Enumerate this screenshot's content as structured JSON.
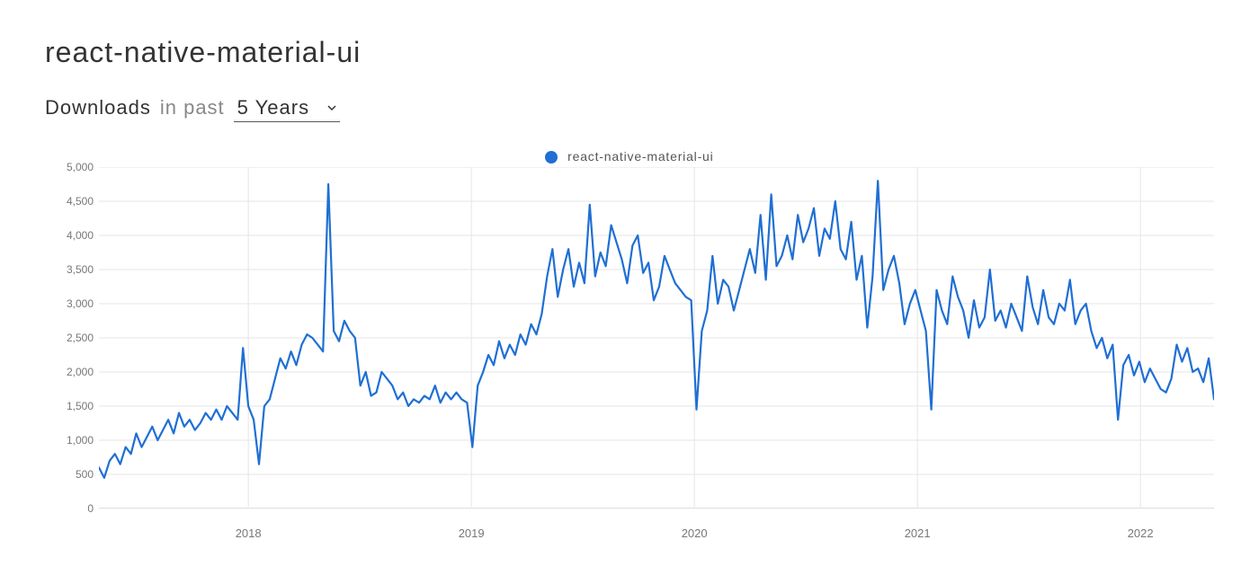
{
  "title": "react-native-material-ui",
  "subtitle": {
    "bold": "Downloads",
    "light": "in past"
  },
  "range": {
    "selected": "5 Years"
  },
  "legend": {
    "series_name": "react-native-material-ui",
    "color": "#1f6fd4"
  },
  "chart_data": {
    "type": "line",
    "title": "",
    "xlabel": "",
    "ylabel": "",
    "ylim": [
      0,
      5000
    ],
    "y_ticks": [
      "0",
      "500",
      "1,000",
      "1,500",
      "2,000",
      "2,500",
      "3,000",
      "3,500",
      "4,000",
      "4,500",
      "5,000"
    ],
    "x_ticks": [
      "2018",
      "2019",
      "2020",
      "2021",
      "2022"
    ],
    "x_start_year": 2017.33,
    "x_end_year": 2022.33,
    "series": [
      {
        "name": "react-native-material-ui",
        "color": "#1f6fd4",
        "values": [
          600,
          450,
          700,
          800,
          650,
          900,
          800,
          1100,
          900,
          1050,
          1200,
          1000,
          1150,
          1300,
          1100,
          1400,
          1200,
          1300,
          1150,
          1250,
          1400,
          1300,
          1450,
          1300,
          1500,
          1400,
          1300,
          2350,
          1500,
          1300,
          650,
          1500,
          1600,
          1900,
          2200,
          2050,
          2300,
          2100,
          2400,
          2550,
          2500,
          2400,
          2300,
          4750,
          2600,
          2450,
          2750,
          2600,
          2500,
          1800,
          2000,
          1650,
          1700,
          2000,
          1900,
          1800,
          1600,
          1700,
          1500,
          1600,
          1550,
          1650,
          1600,
          1800,
          1550,
          1700,
          1600,
          1700,
          1600,
          1550,
          900,
          1800,
          2000,
          2250,
          2100,
          2450,
          2200,
          2400,
          2250,
          2550,
          2400,
          2700,
          2550,
          2850,
          3400,
          3800,
          3100,
          3500,
          3800,
          3250,
          3600,
          3300,
          4450,
          3400,
          3750,
          3550,
          4150,
          3900,
          3650,
          3300,
          3850,
          4000,
          3450,
          3600,
          3050,
          3250,
          3700,
          3500,
          3300,
          3200,
          3100,
          3050,
          1450,
          2600,
          2900,
          3700,
          3000,
          3350,
          3250,
          2900,
          3200,
          3500,
          3800,
          3450,
          4300,
          3350,
          4600,
          3550,
          3700,
          4000,
          3650,
          4300,
          3900,
          4100,
          4400,
          3700,
          4100,
          3950,
          4500,
          3800,
          3650,
          4200,
          3350,
          3700,
          2650,
          3400,
          4800,
          3200,
          3500,
          3700,
          3300,
          2700,
          3000,
          3200,
          2900,
          2600,
          1450,
          3200,
          2900,
          2700,
          3400,
          3100,
          2900,
          2500,
          3050,
          2650,
          2800,
          3500,
          2750,
          2900,
          2650,
          3000,
          2800,
          2600,
          3400,
          2950,
          2700,
          3200,
          2800,
          2700,
          3000,
          2900,
          3350,
          2700,
          2900,
          3000,
          2600,
          2350,
          2500,
          2200,
          2400,
          1300,
          2100,
          2250,
          1950,
          2150,
          1850,
          2050,
          1900,
          1750,
          1700,
          1900,
          2400,
          2150,
          2350,
          2000,
          2050,
          1850,
          2200,
          1600
        ]
      }
    ]
  }
}
